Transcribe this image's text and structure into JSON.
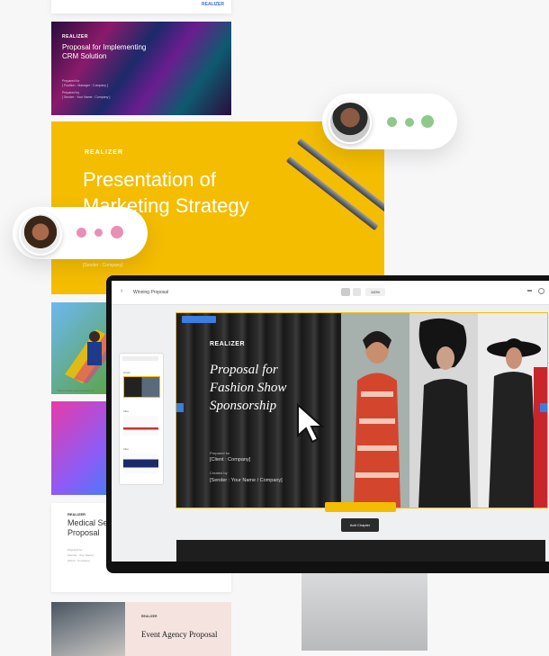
{
  "cards": {
    "top": {
      "link": "REALIZER"
    },
    "crm": {
      "brand": "REALIZER",
      "title": "Proposal for Implementing CRM Solution",
      "prepared_for_label": "Prepared for",
      "prepared_for_value": "[ Position : Manager : Company ]",
      "prepared_by_label": "Prepared by",
      "prepared_by_value": "[ Sender : Your Name : Company ]"
    },
    "marketing": {
      "brand": "REALIZER",
      "title": "Presentation of Marketing Strategy",
      "sender": "[Sender : Company]"
    },
    "sports": {
      "caption": "This proposal was prepared for"
    },
    "medical": {
      "brand": "REALIZER",
      "title": "Medical Services Proposal",
      "meta1": "Prepared for",
      "meta2": "[Sender : Your Name]",
      "meta3": "[Client : Company]"
    },
    "event": {
      "brand": "REALIZER",
      "title": "Event Agency Proposal"
    }
  },
  "editor": {
    "window_title": "Winning Proposal",
    "zoom": "100%",
    "slide": {
      "brand": "REALIZER",
      "title": "Proposal for Fashion Show Sponsorship",
      "prepared_for_label": "Prepared for",
      "prepared_for_value": "[Client : Company]",
      "created_by_label": "Created by",
      "created_by_value": "[Sender : Your Name / Company]"
    },
    "add_chapter": "Add Chapter",
    "panel_sections": [
      "Cover",
      "Intro",
      "Intro"
    ]
  },
  "colors": {
    "accent_yellow": "#f5bd00",
    "typing_dots_green": "#8fc98a",
    "typing_dots_pink": "#e98fb5"
  },
  "icons": [
    "back-arrow-icon",
    "cursor-arrow-icon",
    "typing-dots-icon"
  ]
}
